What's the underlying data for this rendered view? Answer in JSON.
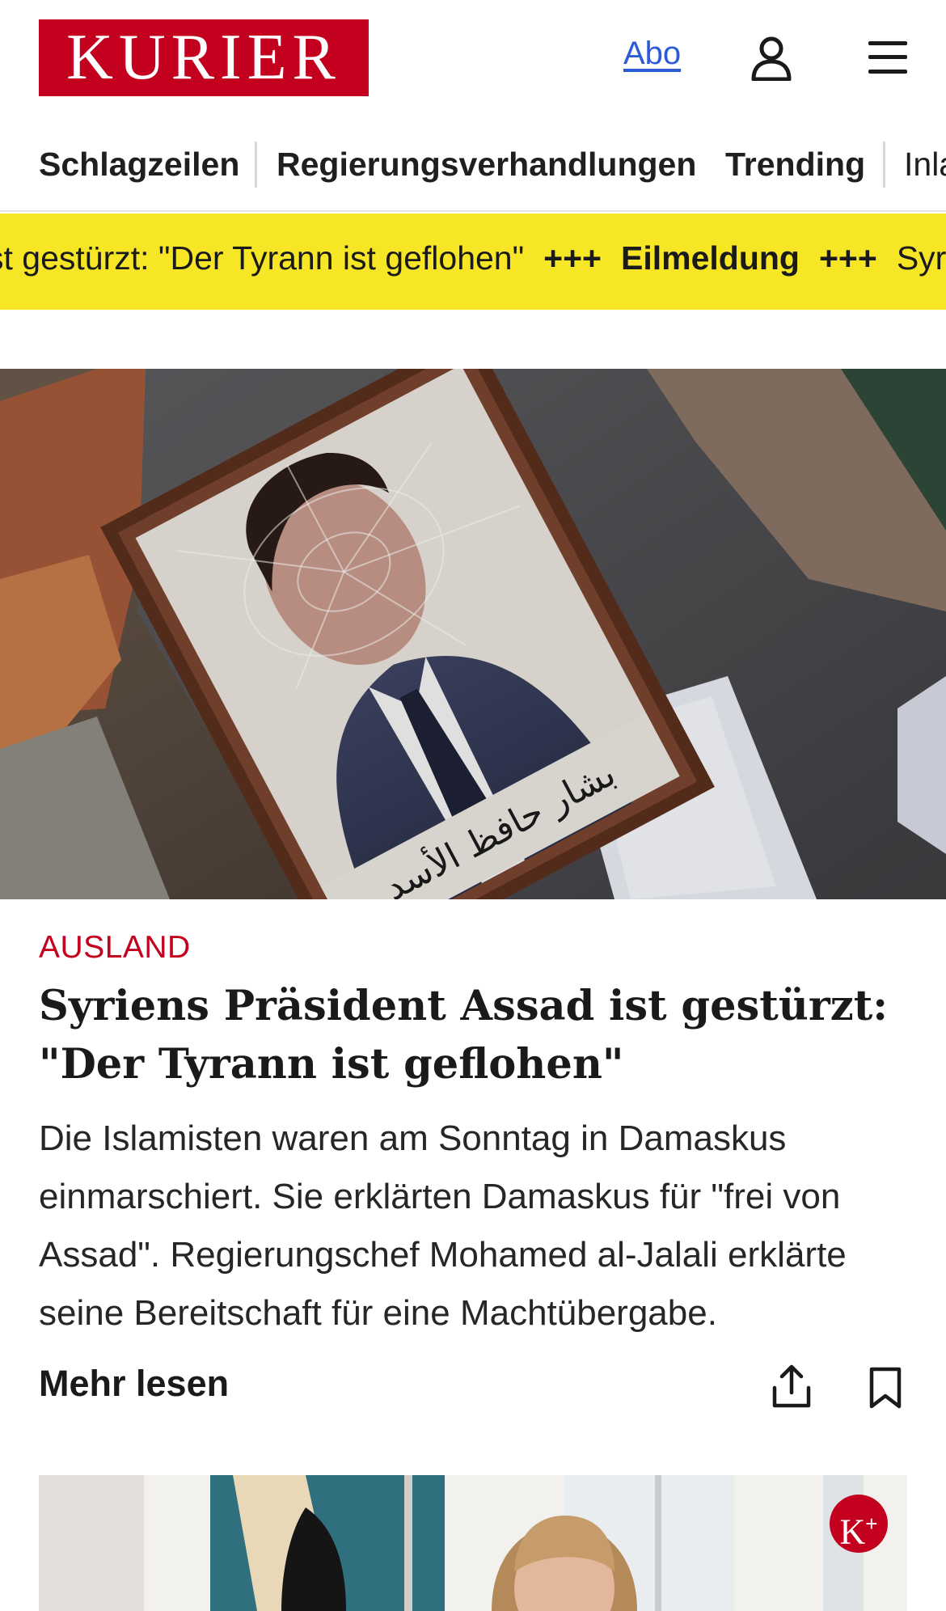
{
  "header": {
    "logo": "KURIER",
    "abo_label": "Abo",
    "icons": [
      "user-icon",
      "menu-icon"
    ]
  },
  "nav": {
    "items": [
      "Schlagzeilen",
      "Regierungsverhandlungen",
      "Trending",
      "Inla"
    ]
  },
  "ticker": {
    "segment1": "st gestürzt: \"Der Tyrann ist geflohen\"",
    "separator": "+++",
    "label": "Eilmeldung",
    "segment2": "Syr"
  },
  "hero": {
    "caption_arabic": "بشار حافظ الأسد"
  },
  "article": {
    "kicker": "AUSLAND",
    "headline": "Syriens Präsident Assad ist gestürzt: \"Der Tyrann ist geflohen\"",
    "teaser": "Die Islamisten waren am Sonntag in Damaskus einmarschiert. Sie erklärten Damaskus für \"frei von Assad\". Regierungschef Mohamed al-Jalali erklärte seine Bereitschaft für eine Machtübergabe.",
    "more_label": "Mehr lesen",
    "icons": [
      "share-icon",
      "bookmark-icon"
    ]
  },
  "next_teaser": {
    "badge": "K",
    "badge_sup": "+"
  },
  "colors": {
    "brand_red": "#c3001e",
    "ticker_yellow": "#f6e625",
    "link_blue": "#2b5bd7"
  }
}
